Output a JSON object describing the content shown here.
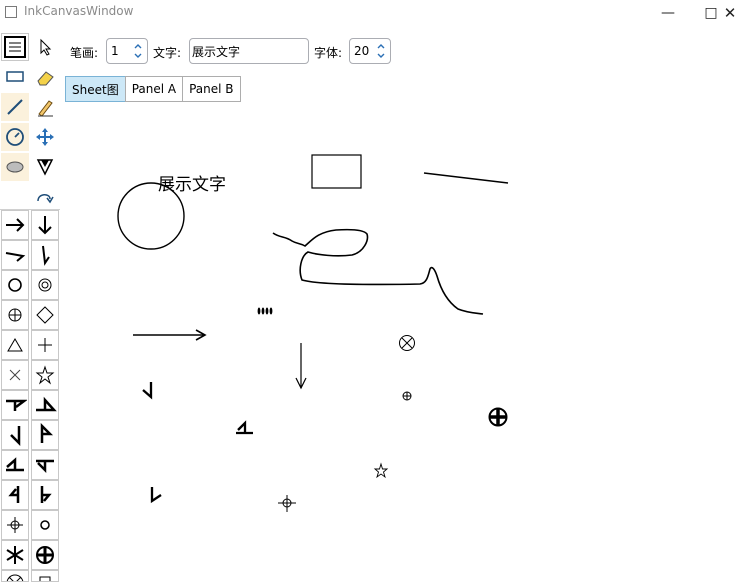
{
  "window": {
    "title": "InkCanvasWindow"
  },
  "controls": {
    "pen_label": "笔画:",
    "pen_value": "1",
    "text_label": "文字:",
    "text_value": "展示文字",
    "font_label": "字体:",
    "font_value": "20"
  },
  "tabs": [
    {
      "label": "Sheet图",
      "selected": true
    },
    {
      "label": "Panel A",
      "selected": false
    },
    {
      "label": "Panel B",
      "selected": false
    }
  ],
  "canvas": {
    "text": "展示文字"
  },
  "toolbar_tools": [
    "document-icon",
    "pointer-icon",
    "rectangle-icon",
    "eraser-icon",
    "line-icon",
    "highlighter-icon",
    "gauge-icon",
    "move-icon",
    "ellipse-icon",
    "funnel-icon",
    "redo-icon"
  ]
}
